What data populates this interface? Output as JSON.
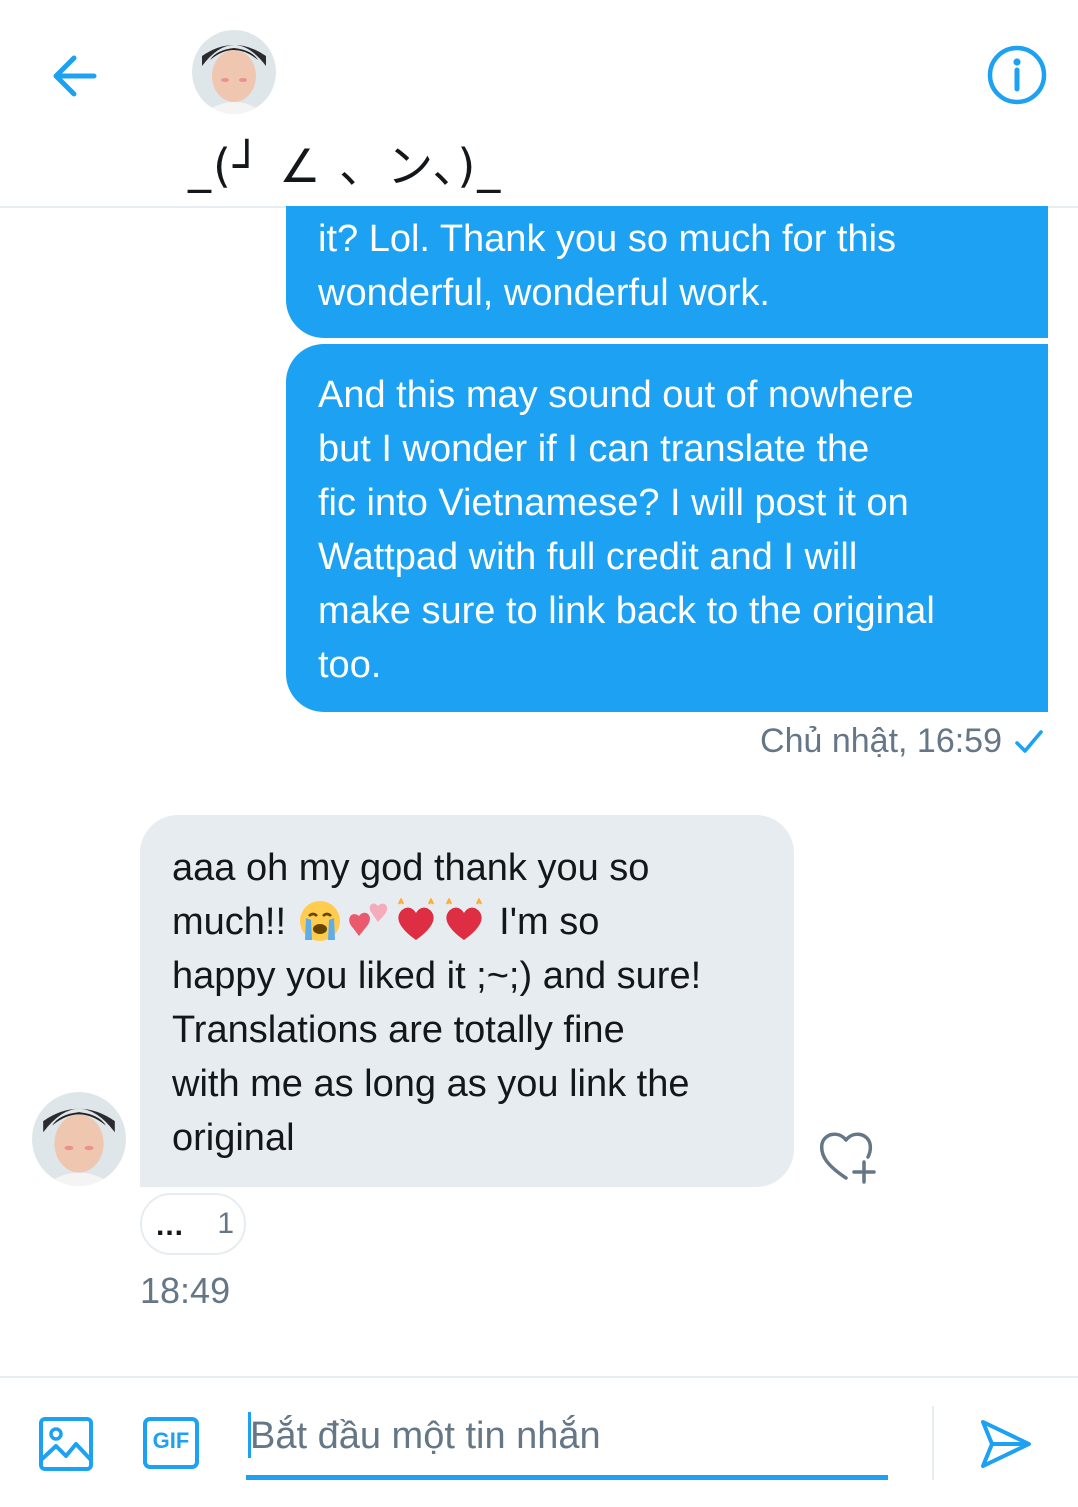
{
  "header": {
    "contact_name": "_(┘ ∠ 、ン、)_"
  },
  "messages_out": [
    {
      "text": "it? Lol. Thank you so much for this\nwonderful, wonderful work."
    },
    {
      "text": "And this may sound out of nowhere\nbut I wonder if I can translate the\nfic into Vietnamese? I will post it on\nWattpad with full credit and I will\nmake sure to link back to the original\ntoo."
    }
  ],
  "out_meta": {
    "timestamp": "Chủ nhật, 16:59"
  },
  "message_in": {
    "line1": "aaa oh my god thank you so",
    "line2_prefix": "much!! ",
    "line2_suffix": " I'm so",
    "line3": "happy you liked it ;~;) and sure!",
    "line4": "Translations are totally fine",
    "line5": "with me as long as you link the",
    "line6": "original",
    "emojis": [
      "crying-face",
      "two-hearts",
      "sparkling-heart",
      "sparkling-heart"
    ],
    "reaction": {
      "dots": "...",
      "count": "1"
    },
    "timestamp": "18:49"
  },
  "composer": {
    "placeholder": "Bắt đầu một tin nhắn",
    "gif_label": "GIF"
  },
  "colors": {
    "accent": "#1da1f2",
    "incoming_bg": "#e6ecf0",
    "meta_text": "#657786"
  }
}
